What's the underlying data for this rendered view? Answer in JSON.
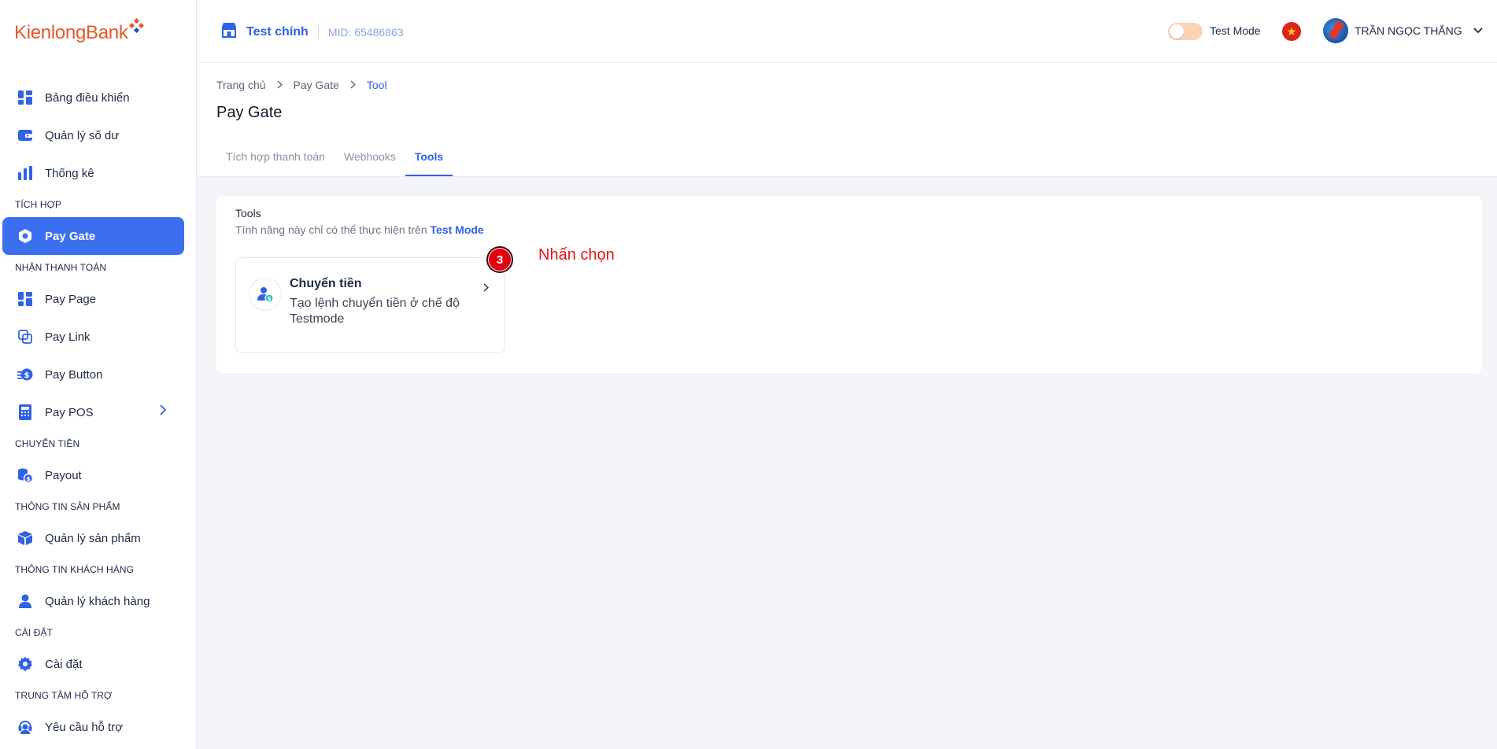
{
  "brand": {
    "name_part1": "Kienlong",
    "name_part2": "Bank"
  },
  "sidebar": {
    "groups": [
      {
        "label": "",
        "items": [
          {
            "label": "Bảng điều khiển",
            "icon": "dashboard-icon"
          },
          {
            "label": "Quản lý số dư",
            "icon": "wallet-icon"
          },
          {
            "label": "Thống kê",
            "icon": "bar-chart-icon"
          }
        ]
      },
      {
        "label": "TÍCH HỢP",
        "items": [
          {
            "label": "Pay Gate",
            "icon": "gateway-icon",
            "active": true
          }
        ]
      },
      {
        "label": "NHẬN THANH TOÁN",
        "items": [
          {
            "label": "Pay Page",
            "icon": "grid-icon"
          },
          {
            "label": "Pay Link",
            "icon": "link-icon"
          },
          {
            "label": "Pay Button",
            "icon": "coin-icon"
          },
          {
            "label": "Pay POS",
            "icon": "pos-icon",
            "expandable": true
          }
        ]
      },
      {
        "label": "CHUYỂN TIỀN",
        "items": [
          {
            "label": "Payout",
            "icon": "payout-icon"
          }
        ]
      },
      {
        "label": "THÔNG TIN SẢN PHẨM",
        "items": [
          {
            "label": "Quản lý sản phẩm",
            "icon": "box-icon"
          }
        ]
      },
      {
        "label": "THÔNG TIN KHÁCH HÀNG",
        "items": [
          {
            "label": "Quản lý khách hàng",
            "icon": "user-icon"
          }
        ]
      },
      {
        "label": "CÀI ĐẶT",
        "items": [
          {
            "label": "Cài đặt",
            "icon": "gear-icon"
          }
        ]
      },
      {
        "label": "TRUNG TÂM HỖ TRỢ",
        "items": [
          {
            "label": "Yêu cầu hỗ trợ",
            "icon": "headset-icon"
          }
        ]
      }
    ]
  },
  "header": {
    "store_name": "Test chính",
    "mid": "MID: 65486863",
    "test_mode_label": "Test Mode",
    "test_mode_on": false,
    "user_name": "TRẦN NGỌC THẮNG"
  },
  "breadcrumb": [
    "Trang chủ",
    "Pay Gate",
    "Tool"
  ],
  "page_title": "Pay Gate",
  "tabs": [
    {
      "label": "Tích hợp thanh toán"
    },
    {
      "label": "Webhooks"
    },
    {
      "label": "Tools",
      "active": true
    }
  ],
  "card": {
    "title": "Tools",
    "subtitle": "Tính năng này chỉ có thể thực hiện trên",
    "subtitle_highlight": "Test Mode",
    "tool": {
      "name": "Chuyển tiền",
      "description": "Tạo lệnh chuyển tiền ở chế độ Testmode"
    }
  },
  "annotation": {
    "step": "3",
    "note": "Nhấn chọn"
  },
  "colors": {
    "primary": "#3b6ff0",
    "brand_orange": "#e8562a",
    "annotation_red": "#e01515"
  }
}
